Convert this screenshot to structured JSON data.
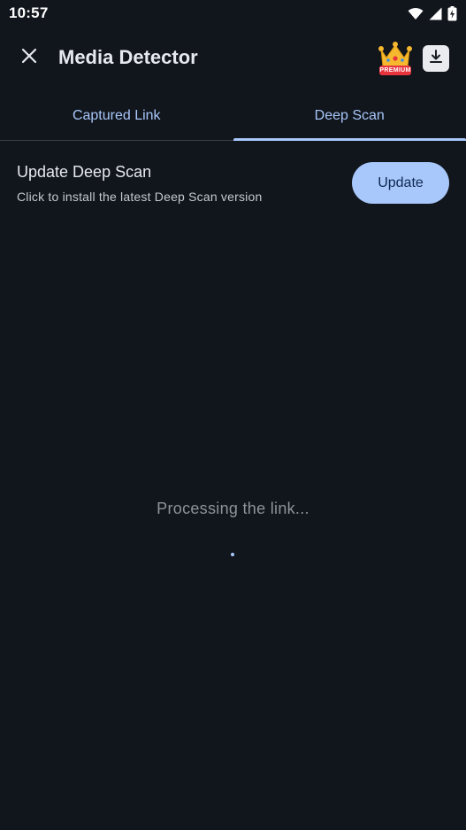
{
  "status_bar": {
    "time": "10:57",
    "icons": [
      "wifi-icon",
      "cell-signal-icon",
      "battery-icon"
    ]
  },
  "app_bar": {
    "title": "Media Detector",
    "close_icon": "close-icon",
    "premium_label": "PREMIUM",
    "premium_icon": "crown-icon",
    "download_icon": "download-icon"
  },
  "tabs": [
    {
      "label": "Captured Link",
      "active": false
    },
    {
      "label": "Deep Scan",
      "active": true
    }
  ],
  "update_card": {
    "title": "Update Deep Scan",
    "description": "Click to install the latest Deep Scan version",
    "button_label": "Update"
  },
  "processing": {
    "text": "Processing the link..."
  },
  "colors": {
    "background": "#11151c",
    "accent": "#a8c7fa",
    "premium_badge": "#e7333e",
    "crown": "#f5b82e"
  }
}
